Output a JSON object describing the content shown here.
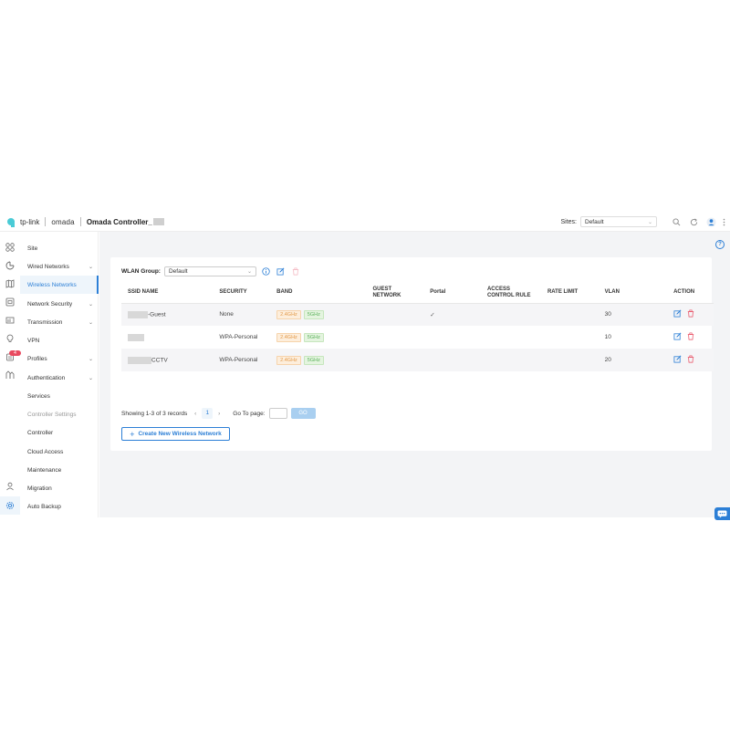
{
  "header": {
    "brand": "tp-link",
    "product": "omada",
    "controller_title": "Omada Controller_",
    "sites_label": "Sites:",
    "sites_value": "Default"
  },
  "sidebar": {
    "items": [
      {
        "label": "Site",
        "has_chevron": false
      },
      {
        "label": "Wired Networks",
        "has_chevron": true
      },
      {
        "label": "Wireless Networks",
        "has_chevron": false,
        "active": true
      },
      {
        "label": "Network Security",
        "has_chevron": true
      },
      {
        "label": "Transmission",
        "has_chevron": true
      },
      {
        "label": "VPN",
        "has_chevron": false
      },
      {
        "label": "Profiles",
        "has_chevron": true
      },
      {
        "label": "Authentication",
        "has_chevron": true
      },
      {
        "label": "Services",
        "has_chevron": false
      },
      {
        "label": "Controller Settings",
        "has_chevron": false,
        "muted": true
      },
      {
        "label": "Controller",
        "has_chevron": false
      },
      {
        "label": "Cloud Access",
        "has_chevron": false
      },
      {
        "label": "Maintenance",
        "has_chevron": false
      },
      {
        "label": "Migration",
        "has_chevron": false
      },
      {
        "label": "Auto Backup",
        "has_chevron": false
      }
    ],
    "badge_count": "4"
  },
  "main": {
    "wlan_group_label": "WLAN Group:",
    "wlan_group_value": "Default",
    "table": {
      "headers": [
        "SSID NAME",
        "SECURITY",
        "BAND",
        "GUEST NETWORK",
        "Portal",
        "ACCESS CONTROL RULE",
        "RATE LIMIT",
        "VLAN",
        "ACTION"
      ],
      "rows": [
        {
          "ssid": "-Guest",
          "security": "None",
          "band_24": "2.4GHz",
          "band_5": "5GHz",
          "guest": "",
          "portal": "✓",
          "acl": "",
          "rate_limit": "",
          "vlan": "30"
        },
        {
          "ssid": "",
          "security": "WPA-Personal",
          "band_24": "2.4GHz",
          "band_5": "5GHz",
          "guest": "",
          "portal": "",
          "acl": "",
          "rate_limit": "",
          "vlan": "10"
        },
        {
          "ssid": "CCTV",
          "security": "WPA-Personal",
          "band_24": "2.4GHz",
          "band_5": "5GHz",
          "guest": "",
          "portal": "",
          "acl": "",
          "rate_limit": "",
          "vlan": "20"
        }
      ]
    },
    "pager": {
      "summary": "Showing 1-3 of 3 records",
      "current_page": "1",
      "goto_label": "Go To page:",
      "go_label": "GO"
    },
    "create_button_label": "Create New Wireless Network"
  },
  "colors": {
    "accent": "#2c7fd6",
    "brand_teal": "#4acbd6",
    "delete_red": "#e84a5f",
    "band_24": "#e39a4a",
    "band_5": "#5bb15b"
  }
}
